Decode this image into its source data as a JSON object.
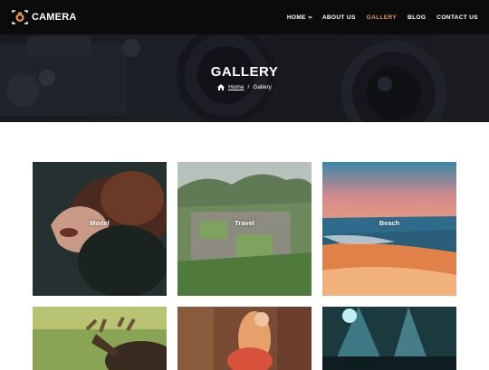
{
  "brand": {
    "name": "CAMERA",
    "logo_icon": "camera-icon"
  },
  "nav": {
    "items": [
      {
        "label": "HOME",
        "dropdown": true,
        "active": false
      },
      {
        "label": "ABOUT US",
        "dropdown": false,
        "active": false
      },
      {
        "label": "GALLERY",
        "dropdown": false,
        "active": true
      },
      {
        "label": "BLOG",
        "dropdown": false,
        "active": false
      },
      {
        "label": "CONTACT US",
        "dropdown": false,
        "active": false
      }
    ],
    "accent_color": "#e2935a"
  },
  "hero": {
    "title": "GALLERY",
    "breadcrumb": {
      "home_label": "Home",
      "separator": "/",
      "current": "Gallery",
      "home_icon": "home-icon"
    }
  },
  "gallery": {
    "items": [
      {
        "label": "Model"
      },
      {
        "label": "Travel"
      },
      {
        "label": "Beach"
      },
      {
        "label": ""
      },
      {
        "label": ""
      },
      {
        "label": ""
      }
    ]
  }
}
